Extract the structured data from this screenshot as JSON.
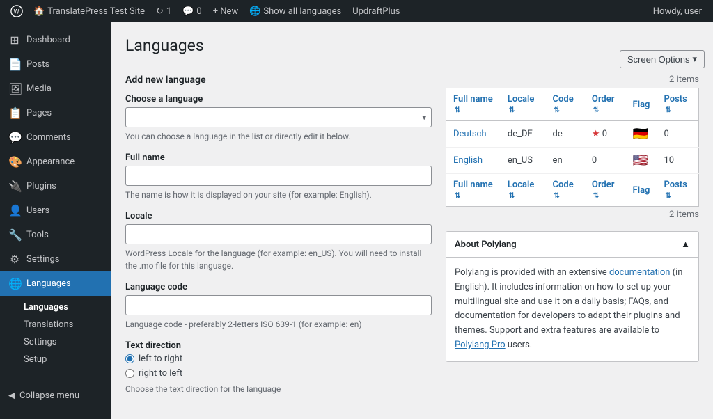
{
  "adminbar": {
    "wp_icon": "⊞",
    "site_name": "TranslatePress Test Site",
    "update_count": "1",
    "comments_count": "0",
    "new_label": "+ New",
    "show_all_languages": "Show all languages",
    "updraftplus": "UpdraftPlus",
    "howdy": "Howdy, user"
  },
  "sidebar": {
    "items": [
      {
        "id": "dashboard",
        "label": "Dashboard",
        "icon": "⊞"
      },
      {
        "id": "posts",
        "label": "Posts",
        "icon": "📄"
      },
      {
        "id": "media",
        "label": "Media",
        "icon": "🖼"
      },
      {
        "id": "pages",
        "label": "Pages",
        "icon": "📋"
      },
      {
        "id": "comments",
        "label": "Comments",
        "icon": "💬"
      },
      {
        "id": "appearance",
        "label": "Appearance",
        "icon": "🎨"
      },
      {
        "id": "plugins",
        "label": "Plugins",
        "icon": "🔌"
      },
      {
        "id": "users",
        "label": "Users",
        "icon": "👤"
      },
      {
        "id": "tools",
        "label": "Tools",
        "icon": "🔧"
      },
      {
        "id": "settings",
        "label": "Settings",
        "icon": "⚙"
      },
      {
        "id": "languages",
        "label": "Languages",
        "icon": "🌐"
      }
    ],
    "languages_submenu": [
      {
        "id": "languages-main",
        "label": "Languages",
        "active": true
      },
      {
        "id": "translations",
        "label": "Translations",
        "active": false
      },
      {
        "id": "lang-settings",
        "label": "Settings",
        "active": false
      },
      {
        "id": "lang-setup",
        "label": "Setup",
        "active": false
      }
    ],
    "collapse_label": "Collapse menu"
  },
  "page": {
    "title": "Languages",
    "screen_options": "Screen Options",
    "screen_options_arrow": "▾"
  },
  "form": {
    "section_title": "Add new language",
    "choose_language_label": "Choose a language",
    "choose_language_placeholder": "",
    "choose_language_description": "You can choose a language in the list or directly edit it below.",
    "choose_language_arrow": "▾",
    "full_name_label": "Full name",
    "full_name_description": "The name is how it is displayed on your site (for example: English).",
    "locale_label": "Locale",
    "locale_description": "WordPress Locale for the language (for example: en_US). You will need to install the .mo file for this language.",
    "language_code_label": "Language code",
    "language_code_description": "Language code - preferably 2-letters ISO 639-1 (for example: en)",
    "text_direction_label": "Text direction",
    "radio_ltr": "left to right",
    "radio_rtl": "right to left",
    "text_direction_description": "Choose the text direction for the language"
  },
  "table": {
    "items_count": "2 items",
    "columns": [
      {
        "id": "full-name",
        "label": "Full name",
        "sortable": true
      },
      {
        "id": "locale",
        "label": "Locale",
        "sortable": true
      },
      {
        "id": "code",
        "label": "Code",
        "sortable": true
      },
      {
        "id": "order",
        "label": "Order",
        "sortable": true
      },
      {
        "id": "flag",
        "label": "Flag",
        "sortable": false
      },
      {
        "id": "posts",
        "label": "Posts",
        "sortable": true
      }
    ],
    "rows": [
      {
        "full_name": "Deutsch",
        "locale": "de_DE",
        "code": "de",
        "order": "0",
        "flag": "🇩🇪",
        "posts": "0",
        "is_default": true
      },
      {
        "full_name": "English",
        "locale": "en_US",
        "code": "en",
        "order": "0",
        "flag": "🇺🇸",
        "posts": "10",
        "is_default": false
      }
    ],
    "footer_count": "2 items"
  },
  "about_polylang": {
    "title": "About Polylang",
    "collapse_icon": "▲",
    "content_pre": "Polylang is provided with an extensive ",
    "documentation_link": "documentation",
    "content_mid": " (in English). It includes information on how to set up your multilingual site and use it on a daily basis; FAQs, and documentation for developers to adapt their plugins and themes. Support and extra features are available to ",
    "polylang_pro_link": "Polylang Pro",
    "content_post": " users."
  }
}
